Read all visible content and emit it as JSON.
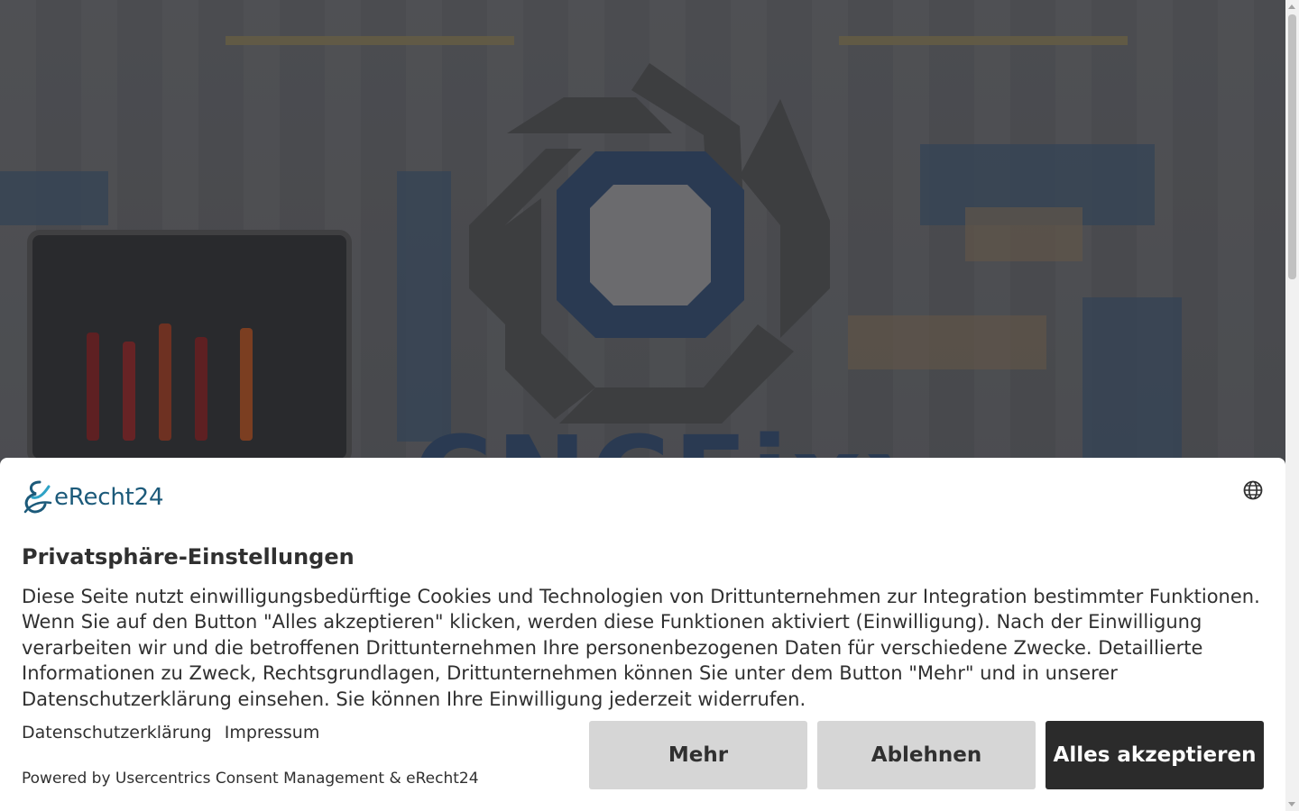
{
  "colors": {
    "accent_dark": "#2b2b2b",
    "button_gray": "#d6d6d6",
    "brand_teal": "#1c5a7a",
    "logo_navy": "#2a3a52"
  },
  "hero": {
    "logo_text": "CNCFixx"
  },
  "consent": {
    "brand_name": "eRecht24",
    "language_icon": "globe-icon",
    "title": "Privatsphäre-Einstellungen",
    "description": "Diese Seite nutzt einwilligungsbedürftige Cookies und Technologien von Drittunternehmen zur Integration bestimmter Funktionen. Wenn Sie auf den Button \"Alles akzeptieren\" klicken, werden diese Funktionen aktiviert (Einwilligung). Nach der Einwilligung verarbeiten wir und die betroffenen Drittunternehmen Ihre personenbezogenen Daten für verschiedene Zwecke. Detaillierte Informationen zu Zweck, Rechtsgrundlagen, Drittunternehmen können Sie unter dem Button \"Mehr\" und in unserer Datenschutzerklärung einsehen. Sie können Ihre Einwilligung jederzeit widerrufen.",
    "links": {
      "privacy": "Datenschutzerklärung",
      "imprint": "Impressum"
    },
    "powered_by": "Powered by Usercentrics Consent Management & eRecht24",
    "buttons": {
      "more": "Mehr",
      "deny": "Ablehnen",
      "accept": "Alles akzeptieren"
    }
  }
}
